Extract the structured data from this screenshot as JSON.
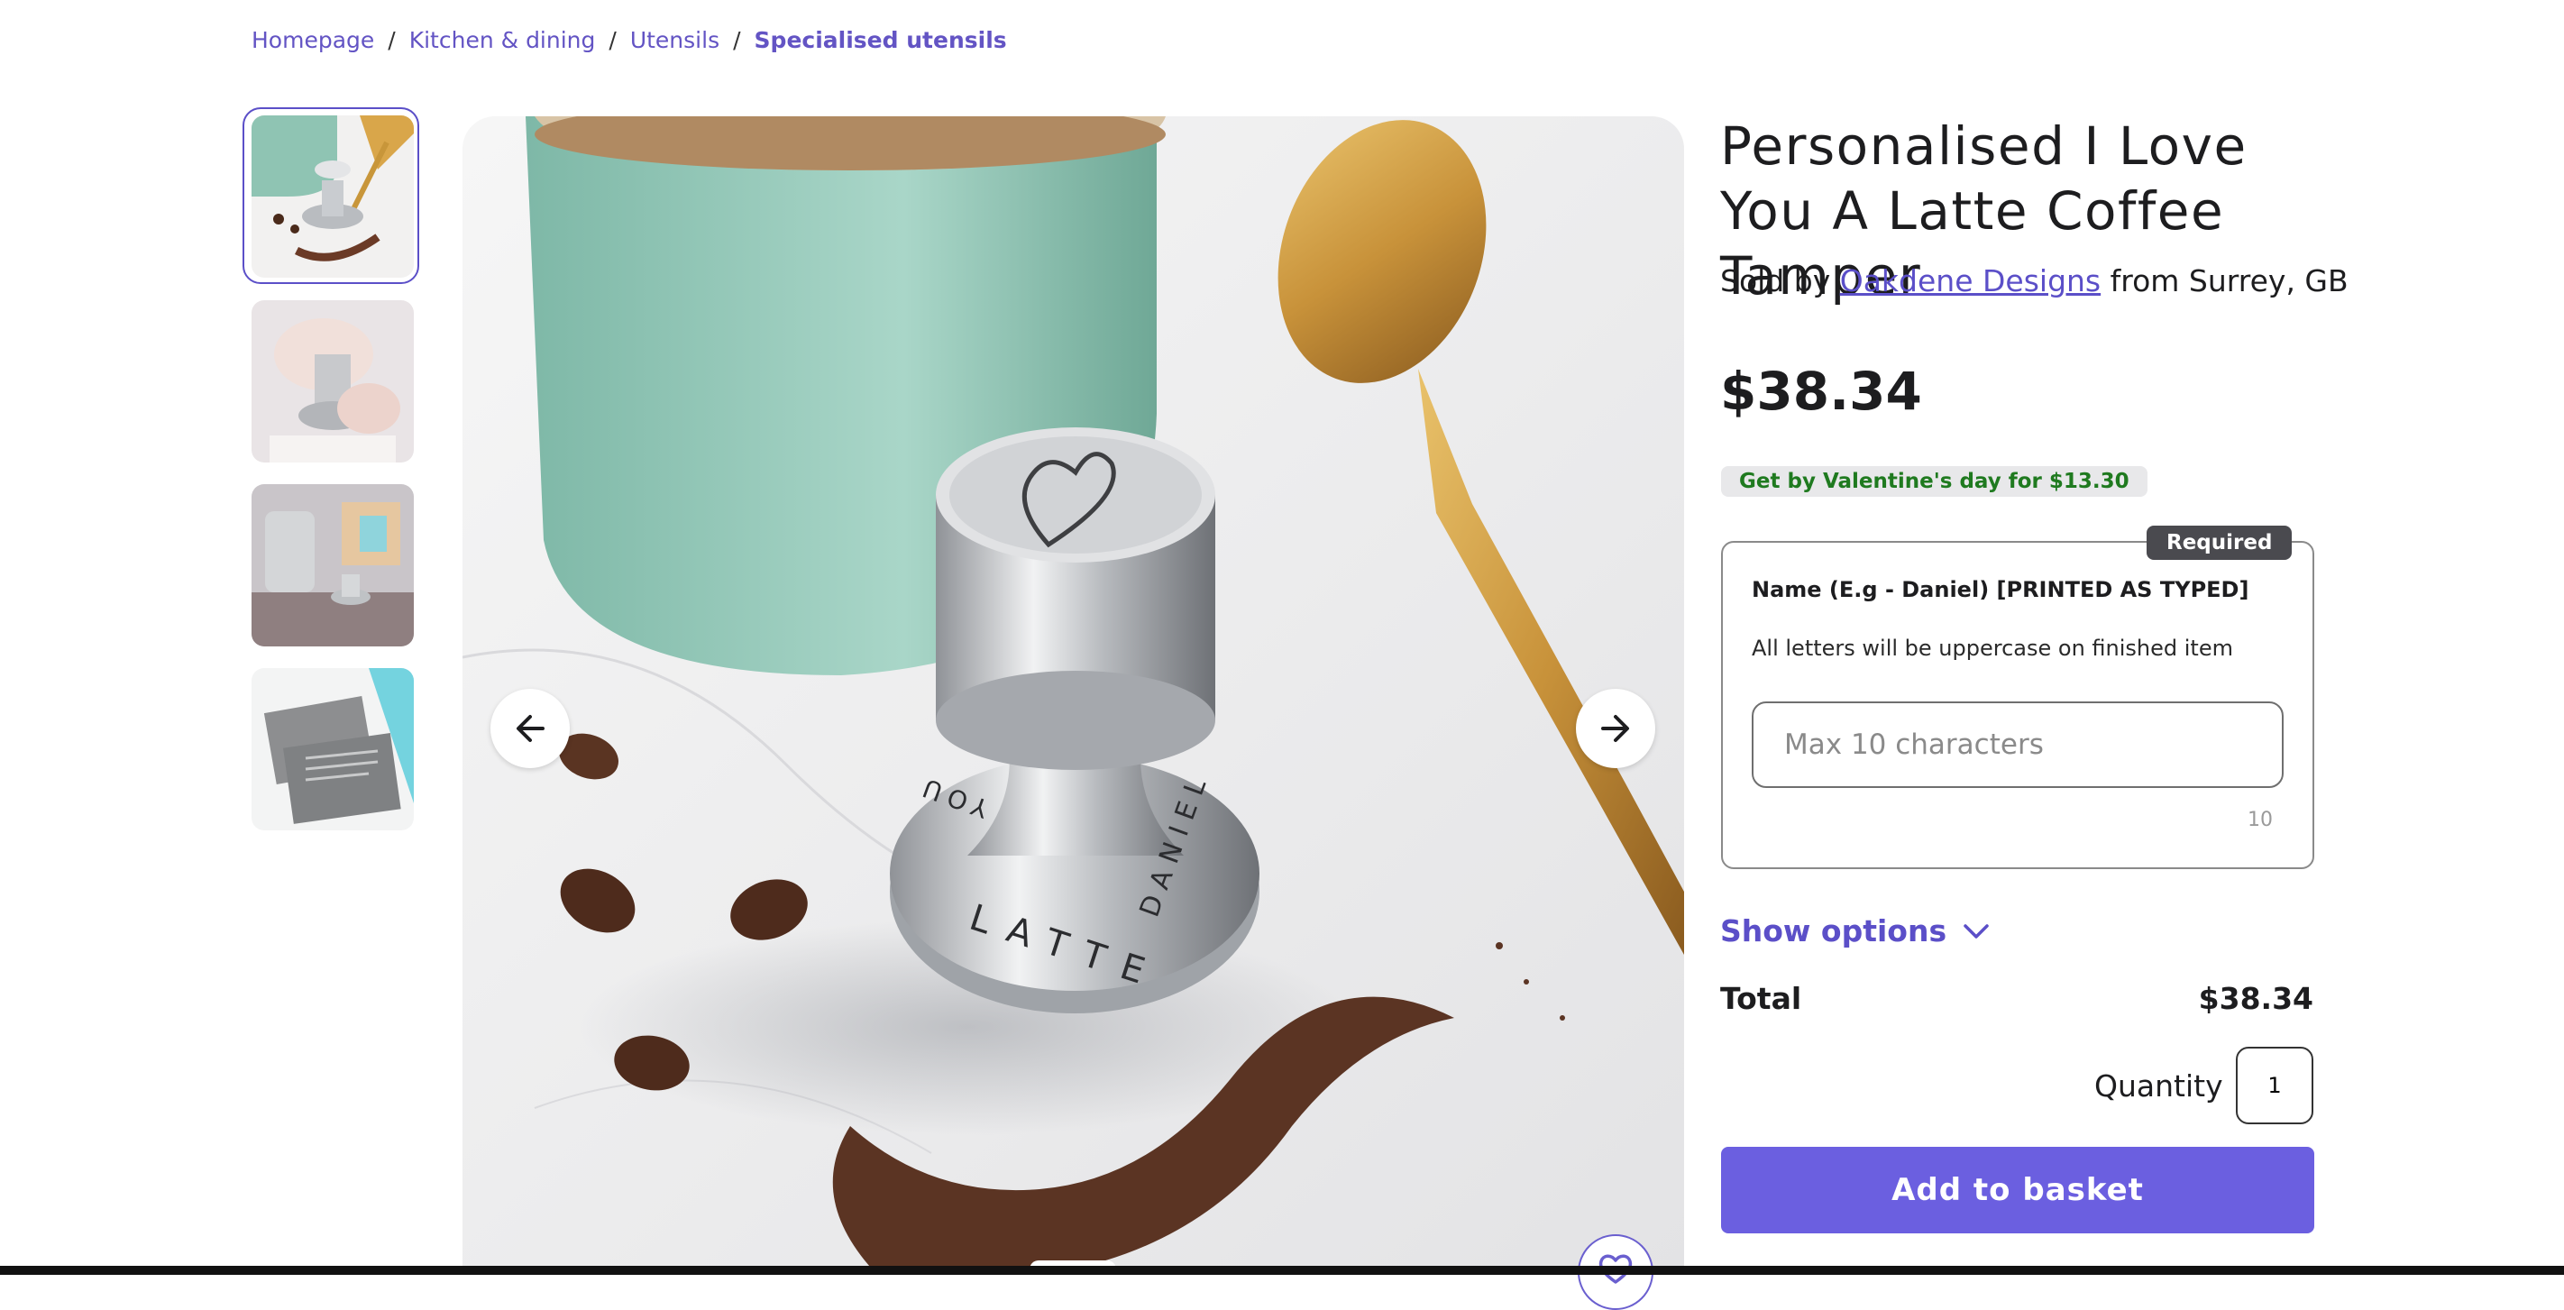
{
  "breadcrumb": {
    "items": [
      "Homepage",
      "Kitchen & dining",
      "Utensils"
    ],
    "current": "Specialised utensils",
    "separator": "/"
  },
  "product": {
    "title": "Personalised I Love You A Latte Coffee Tamper",
    "seller_prefix": "Sold by",
    "seller_name": "Oakdene Designs",
    "seller_suffix": "from Surrey, GB",
    "price": "$38.34",
    "delivery_badge": "Get by Valentine's day for $13.30"
  },
  "personalisation": {
    "required_badge": "Required",
    "label": "Name (E.g - Daniel) [PRINTED AS TYPED]",
    "help": "All letters will be uppercase on finished item",
    "placeholder": "Max 10 characters",
    "value": "",
    "char_count": "10"
  },
  "options": {
    "show_options_label": "Show options"
  },
  "summary": {
    "total_label": "Total",
    "total_value": "$38.34",
    "quantity_label": "Quantity",
    "quantity_value": "1"
  },
  "actions": {
    "add_to_basket": "Add to basket"
  },
  "image_gallery": {
    "main_image_text": [
      "LATTE",
      "DANIEL",
      "YOU"
    ],
    "thumbnails": 4,
    "selected_thumbnail": 1
  },
  "icons": {
    "prev": "arrow-left-icon",
    "next": "arrow-right-icon",
    "favourite": "heart-icon",
    "show_options": "chevron-down-icon"
  },
  "colors": {
    "accent": "#6b5fe0",
    "link": "#5b4fc8",
    "delivery_text": "#1f7a1f",
    "delivery_bg": "#e8e8ea",
    "required_bg": "#4a4a4f"
  }
}
